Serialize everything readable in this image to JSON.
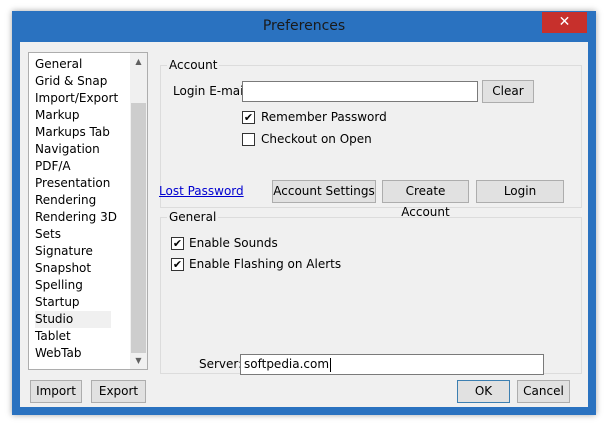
{
  "window": {
    "title": "Preferences",
    "close_glyph": "✕"
  },
  "categories": [
    "General",
    "Grid & Snap",
    "Import/Export",
    "Markup",
    "Markups Tab",
    "Navigation",
    "PDF/A",
    "Presentation",
    "Rendering",
    "Rendering 3D",
    "Sets",
    "Signature",
    "Snapshot",
    "Spelling",
    "Startup",
    "Studio",
    "Tablet",
    "WebTab"
  ],
  "selected_category": "Studio",
  "left_buttons": {
    "import": "Import",
    "export": "Export"
  },
  "account": {
    "label": "Account",
    "email_label": "Login E-mail:",
    "email_value": "",
    "clear_button": "Clear",
    "remember_password": {
      "label": "Remember Password",
      "checked": true
    },
    "checkout_on_open": {
      "label": "Checkout on Open",
      "checked": false
    },
    "lost_password_link": "Lost Password",
    "account_settings_button": "Account Settings",
    "create_account_button": "Create Account",
    "login_button": "Login"
  },
  "general": {
    "label": "General",
    "enable_sounds": {
      "label": "Enable Sounds",
      "checked": true
    },
    "enable_flashing": {
      "label": "Enable Flashing on Alerts",
      "checked": true
    },
    "server_label": "Server:",
    "server_value": "softpedia.com"
  },
  "dialog_buttons": {
    "ok": "OK",
    "cancel": "Cancel"
  },
  "icons": {
    "check": "✔",
    "scroll_up": "▲",
    "scroll_down": "▼"
  },
  "colors": {
    "title_bar": "#2a72c0",
    "close_button": "#c7302c",
    "link": "#0000d0"
  }
}
